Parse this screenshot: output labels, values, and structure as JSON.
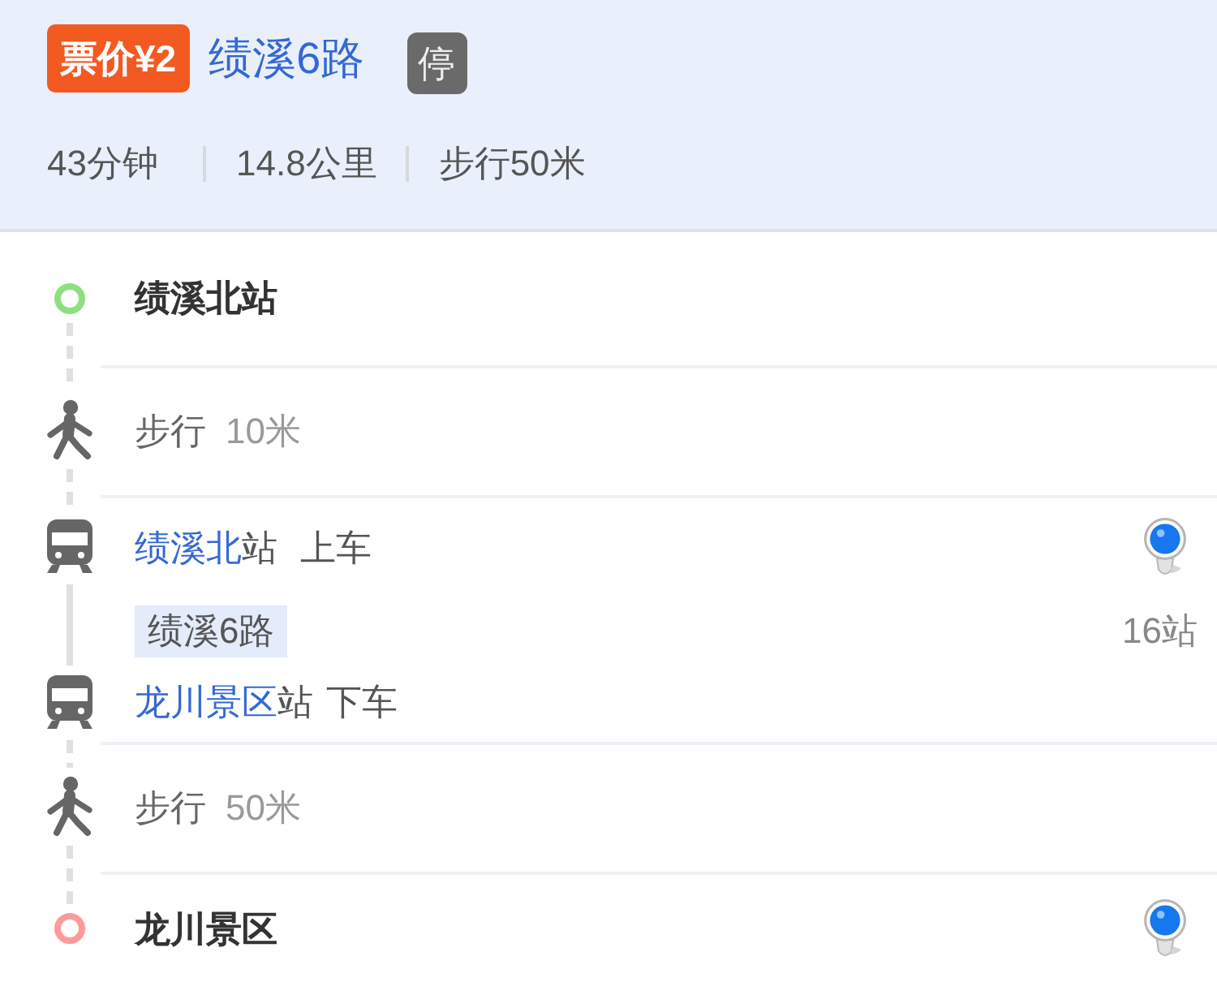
{
  "header": {
    "fare": "票价¥2",
    "route_name": "绩溪6路",
    "stop_badge": "停",
    "duration": "43分钟",
    "distance": "14.8公里",
    "walking": "步行50米"
  },
  "steps": [
    {
      "kind": "start",
      "name": "绩溪北站",
      "color": "#8ee07e"
    },
    {
      "kind": "walk",
      "label": "步行",
      "distance": "10米"
    },
    {
      "kind": "bus",
      "board": {
        "station": "绩溪北",
        "suffix": "站",
        "action": "上车"
      },
      "line": "绩溪6路",
      "stops": "16站",
      "alight": {
        "station": "龙川景区",
        "suffix": "站",
        "action": "下车"
      }
    },
    {
      "kind": "walk",
      "label": "步行",
      "distance": "50米"
    },
    {
      "kind": "end",
      "name": "龙川景区",
      "color": "#ff9a9a"
    }
  ]
}
